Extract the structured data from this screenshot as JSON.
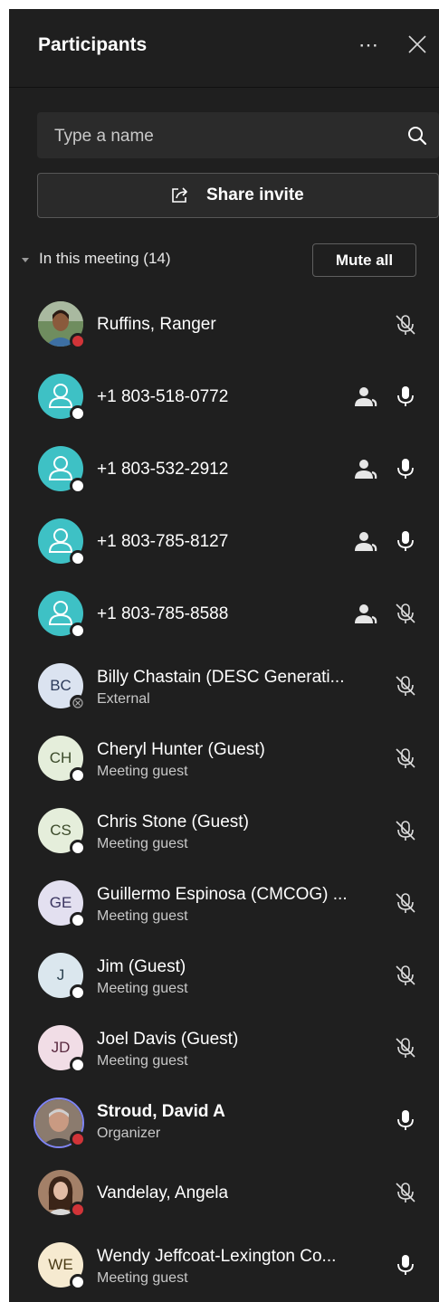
{
  "header": {
    "title": "Participants",
    "more_icon": "more-icon",
    "close_icon": "close-icon"
  },
  "search": {
    "placeholder": "Type a name",
    "value": ""
  },
  "share": {
    "label": "Share invite"
  },
  "section": {
    "label": "In this meeting (14)",
    "mute_all": "Mute all"
  },
  "colors": {
    "teal": "#3ec1c5",
    "available": "#ffffff",
    "busy": "#d13438",
    "panel": "#1f1f1f"
  },
  "participants": [
    {
      "name": "Ruffins, Ranger",
      "subtitle": "",
      "initials": "",
      "avatar": "photo",
      "status": "busy",
      "mic": "muted",
      "phone": false
    },
    {
      "name": "+1 803-518-0772",
      "subtitle": "",
      "initials": "",
      "avatar": "phone-user",
      "status": "available",
      "mic": "on",
      "phone": true
    },
    {
      "name": "+1 803-532-2912",
      "subtitle": "",
      "initials": "",
      "avatar": "phone-user",
      "status": "available",
      "mic": "on",
      "phone": true
    },
    {
      "name": "+1 803-785-8127",
      "subtitle": "",
      "initials": "",
      "avatar": "phone-user",
      "status": "available",
      "mic": "on",
      "phone": true
    },
    {
      "name": "+1 803-785-8588",
      "subtitle": "",
      "initials": "",
      "avatar": "phone-user",
      "status": "available",
      "mic": "muted",
      "phone": true
    },
    {
      "name": "Billy Chastain (DESC Generati...",
      "subtitle": "External",
      "initials": "BC",
      "avatar": "initials",
      "status": "external",
      "mic": "muted",
      "phone": false
    },
    {
      "name": "Cheryl Hunter (Guest)",
      "subtitle": "Meeting guest",
      "initials": "CH",
      "avatar": "initials",
      "status": "available",
      "mic": "muted",
      "phone": false
    },
    {
      "name": "Chris Stone (Guest)",
      "subtitle": "Meeting guest",
      "initials": "CS",
      "avatar": "initials",
      "status": "available",
      "mic": "muted",
      "phone": false
    },
    {
      "name": "Guillermo Espinosa (CMCOG) ...",
      "subtitle": "Meeting guest",
      "initials": "GE",
      "avatar": "initials",
      "status": "available",
      "mic": "muted",
      "phone": false
    },
    {
      "name": "Jim (Guest)",
      "subtitle": "Meeting guest",
      "initials": "J",
      "avatar": "initials",
      "status": "available",
      "mic": "muted",
      "phone": false
    },
    {
      "name": "Joel Davis (Guest)",
      "subtitle": "Meeting guest",
      "initials": "JD",
      "avatar": "initials",
      "status": "available",
      "mic": "muted",
      "phone": false
    },
    {
      "name": "Stroud, David A",
      "subtitle": "Organizer",
      "initials": "",
      "avatar": "photo",
      "status": "busy",
      "mic": "on",
      "phone": false
    },
    {
      "name": "Vandelay, Angela",
      "subtitle": "",
      "initials": "",
      "avatar": "photo",
      "status": "busy",
      "mic": "muted",
      "phone": false
    },
    {
      "name": "Wendy Jeffcoat-Lexington Co...",
      "subtitle": "Meeting guest",
      "initials": "WE",
      "avatar": "initials",
      "status": "available",
      "mic": "on",
      "phone": false
    }
  ]
}
